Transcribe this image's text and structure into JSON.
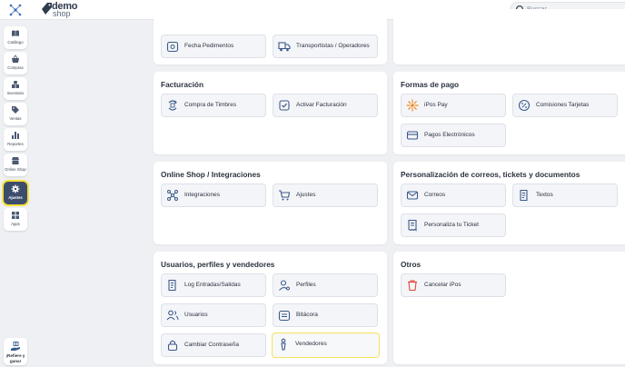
{
  "brand": {
    "name_top": "demo",
    "name_bottom": "shop"
  },
  "search": {
    "placeholder": "Buscar..."
  },
  "sidebar": {
    "items": [
      {
        "label": "Catálogo"
      },
      {
        "label": "Compras"
      },
      {
        "label": "Inventario"
      },
      {
        "label": "Ventas"
      },
      {
        "label": "Reportes"
      },
      {
        "label": "Online Shop"
      },
      {
        "label": "Ajustes",
        "active": true
      },
      {
        "label": "Apps"
      }
    ],
    "referral": {
      "line1": "¡Refiere y",
      "line2": "gana!"
    }
  },
  "sections": {
    "top": {
      "tiles": [
        {
          "label": "Fecha Pedimentos"
        },
        {
          "label": "Transportistas / Operadores"
        }
      ]
    },
    "facturacion": {
      "title": "Facturación",
      "tiles": [
        {
          "label": "Compra de Timbres"
        },
        {
          "label": "Activar Facturación"
        }
      ]
    },
    "formas_pago": {
      "title": "Formas de pago",
      "tiles": [
        {
          "label": "iPos Pay"
        },
        {
          "label": "Comisiones Tarjetas"
        },
        {
          "label": "Pagos Electrónicos"
        }
      ]
    },
    "online_shop": {
      "title": "Online Shop / Integraciones",
      "tiles": [
        {
          "label": "Integraciones"
        },
        {
          "label": "Ajustes"
        }
      ]
    },
    "personalizacion": {
      "title": "Personalización de correos, tickets y documentos",
      "tiles": [
        {
          "label": "Correos"
        },
        {
          "label": "Textos"
        },
        {
          "label": "Personaliza tu Ticket"
        }
      ]
    },
    "usuarios": {
      "title": "Usuarios, perfiles y vendedores",
      "tiles": [
        {
          "label": "Log Entradas/Salidas"
        },
        {
          "label": "Perfiles"
        },
        {
          "label": "Usuarios"
        },
        {
          "label": "Bitácora"
        },
        {
          "label": "Cambiar Contraseña"
        },
        {
          "label": "Vendedores",
          "highlighted": true
        }
      ]
    },
    "otros": {
      "title": "Otros",
      "tiles": [
        {
          "label": "Cancelar iPos"
        }
      ]
    }
  },
  "colors": {
    "accent": "#3b4d6b",
    "highlight": "#f4e45a",
    "icon": "#3b5a8a",
    "ipos_pay": "#f08a2a",
    "cancel": "#e04a3a"
  }
}
